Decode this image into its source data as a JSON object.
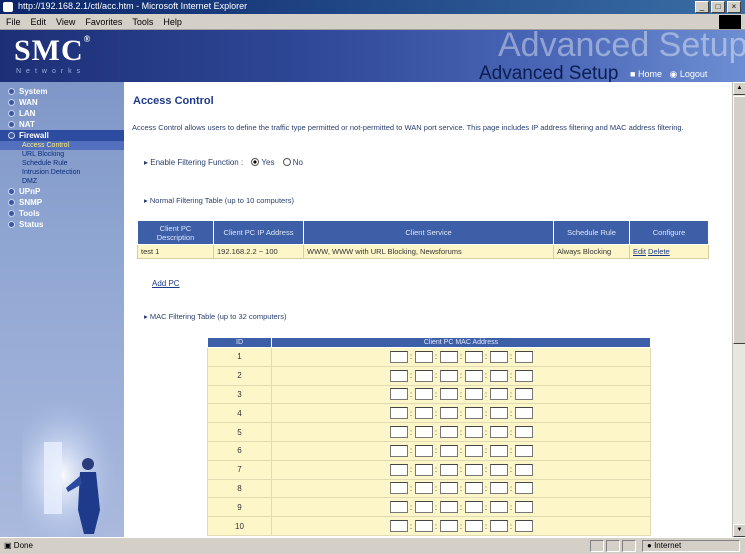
{
  "window": {
    "title": "http://192.168.2.1/ctl/acc.htm - Microsoft Internet Explorer",
    "min": "_",
    "max": "□",
    "close": "×"
  },
  "menu": [
    "File",
    "Edit",
    "View",
    "Favorites",
    "Tools",
    "Help"
  ],
  "header": {
    "logo": "SMC",
    "logo_reg": "®",
    "logo_sub": "Networks",
    "ghost_text": "Advanced Setup",
    "title": "Advanced Setup",
    "home_link": "Home",
    "logout_link": "Logout"
  },
  "sidebar": {
    "items": [
      {
        "label": "System"
      },
      {
        "label": "WAN"
      },
      {
        "label": "LAN"
      },
      {
        "label": "NAT"
      },
      {
        "label": "Firewall"
      },
      {
        "label": "UPnP"
      },
      {
        "label": "SNMP"
      },
      {
        "label": "Tools"
      },
      {
        "label": "Status"
      }
    ],
    "subitems": [
      "Access Control",
      "URL Blocking",
      "Schedule Rule",
      "Intrusion Detection",
      "DMZ"
    ]
  },
  "main": {
    "title": "Access Control",
    "intro": "Access Control allows users to define the traffic type permitted or not-permitted to WAN port service. This page includes IP address filtering and MAC address filtering.",
    "enable_filtering_label": "Enable Filtering Function :",
    "yes_label": "Yes",
    "no_label": "No",
    "normal_table_label": "Normal Filtering Table (up to 10 computers)",
    "normal_table": {
      "headers": [
        "Client PC Description",
        "Client PC IP Address",
        "Client Service",
        "Schedule Rule",
        "Configure"
      ],
      "rows": [
        {
          "description": "test 1",
          "ip": "192.168.2.2 ~ 100",
          "service": "WWW, WWW with URL Blocking, Newsforums",
          "schedule": "Always Blocking",
          "edit": "Edit",
          "delete": "Delete"
        }
      ]
    },
    "add_pc": "Add PC",
    "mac_table_label": "MAC Filtering Table (up to 32 computers)",
    "mac_table": {
      "headers": [
        "ID",
        "Client PC MAC Address"
      ],
      "ids": [
        "1",
        "2",
        "3",
        "4",
        "5",
        "6",
        "7",
        "8",
        "9",
        "10"
      ],
      "separator": ":"
    }
  },
  "status": {
    "text": "Done",
    "zone": "Internet"
  },
  "colors": {
    "header_dark": "#1d2f76",
    "table_header": "#3d5fa8",
    "table_cell": "#fdf6c8",
    "title_blue": "#1d3a88"
  }
}
